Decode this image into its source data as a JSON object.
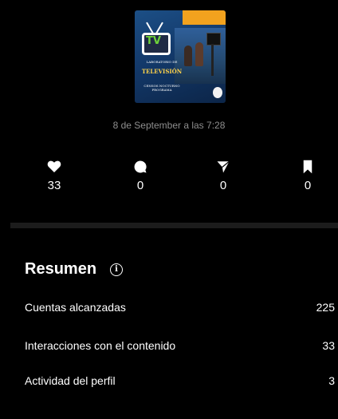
{
  "post": {
    "thumbnail_label": "LABORATORIO DE",
    "thumbnail_title": "TELEVISIÓN",
    "thumbnail_subtitle": "CENSOS NOCTURNO PROGRAMA",
    "thumbnail_logo": "TV",
    "timestamp": "8 de September a las 7:28"
  },
  "stats": [
    {
      "icon": "heart-icon",
      "value": "33"
    },
    {
      "icon": "comment-icon",
      "value": "0"
    },
    {
      "icon": "send-icon",
      "value": "0"
    },
    {
      "icon": "bookmark-icon",
      "value": "0"
    }
  ],
  "summary": {
    "title": "Resumen",
    "info_glyph": "i",
    "rows": [
      {
        "label": "Cuentas alcanzadas",
        "value": "225"
      },
      {
        "label": "Interacciones con el contenido",
        "value": "33"
      },
      {
        "label": "Actividad del perfil",
        "value": "3"
      }
    ]
  },
  "colors": {
    "background": "#000000",
    "text_primary": "#ffffff",
    "text_secondary": "#8e8e8e",
    "divider": "#1c1c1c"
  }
}
